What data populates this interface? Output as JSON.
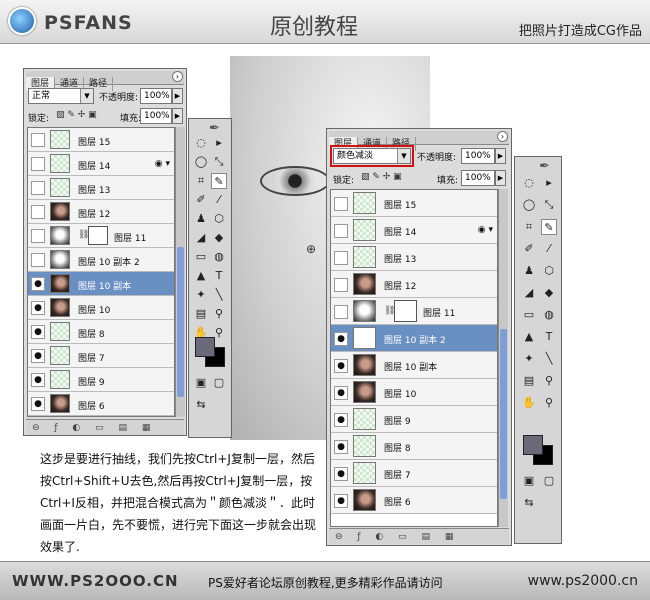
{
  "header": {
    "logo": "PSFANS",
    "title": "原创教程",
    "subtitle": "把照片打造成CG作品"
  },
  "left_panel": {
    "tabs": [
      "图层",
      "通道",
      "路径"
    ],
    "blend_mode": "正常",
    "opacity_label": "不透明度:",
    "opacity": "100%",
    "lock_label": "锁定:",
    "fill_label": "填充:",
    "fill": "100%",
    "layers": [
      {
        "name": "图层 15",
        "thumb": "grid",
        "visible": false
      },
      {
        "name": "图层 14",
        "thumb": "grid",
        "visible": false,
        "fx": true
      },
      {
        "name": "图层 13",
        "thumb": "grid",
        "visible": false
      },
      {
        "name": "图层 12",
        "thumb": "face",
        "visible": false
      },
      {
        "name": "图层 11",
        "thumb": "bw",
        "visible": false,
        "mask": true
      },
      {
        "name": "图层 10 副本 2",
        "thumb": "bw",
        "visible": false
      },
      {
        "name": "图层 10 副本",
        "thumb": "face",
        "visible": true,
        "selected": true
      },
      {
        "name": "图层 10",
        "thumb": "face",
        "visible": true
      },
      {
        "name": "图层 8",
        "thumb": "grid",
        "visible": true
      },
      {
        "name": "图层 7",
        "thumb": "grid",
        "visible": true
      },
      {
        "name": "图层 9",
        "thumb": "grid",
        "visible": true
      },
      {
        "name": "图层 6",
        "thumb": "face",
        "visible": true
      }
    ]
  },
  "right_panel": {
    "tabs": [
      "图层",
      "通道",
      "路径"
    ],
    "blend_mode": "颜色减淡",
    "opacity_label": "不透明度:",
    "opacity": "100%",
    "lock_label": "锁定:",
    "fill_label": "填充:",
    "fill": "100%",
    "layers": [
      {
        "name": "图层 15",
        "thumb": "grid",
        "visible": false
      },
      {
        "name": "图层 14",
        "thumb": "grid",
        "visible": false,
        "fx": true
      },
      {
        "name": "图层 13",
        "thumb": "grid",
        "visible": false
      },
      {
        "name": "图层 12",
        "thumb": "face",
        "visible": false
      },
      {
        "name": "图层 11",
        "thumb": "bw",
        "visible": false,
        "mask": true
      },
      {
        "name": "图层 10 副本 2",
        "thumb": "wt",
        "visible": true,
        "selected": true
      },
      {
        "name": "图层 10 副本",
        "thumb": "face",
        "visible": true
      },
      {
        "name": "图层 10",
        "thumb": "face",
        "visible": true
      },
      {
        "name": "图层 9",
        "thumb": "grid",
        "visible": true
      },
      {
        "name": "图层 8",
        "thumb": "grid",
        "visible": true
      },
      {
        "name": "图层 7",
        "thumb": "grid",
        "visible": true
      },
      {
        "name": "图层 6",
        "thumb": "face",
        "visible": true
      }
    ]
  },
  "tools": [
    "◌",
    "▸",
    "◯",
    "⤡",
    "⌗",
    "✎",
    "✐",
    "⁄",
    "♟",
    "⬡",
    "◢",
    "◆",
    "▭",
    "◍",
    "▲",
    "T",
    "✦",
    "╲",
    "▤",
    "⚲",
    "✋",
    "⚲"
  ],
  "description": "这步是要进行抽线，我们先按Ctrl+J复制一层，然后按Ctrl+Shift+U去色,然后再按Ctrl+J复制一层，按Ctrl+I反相，并把混合模式高为＂颜色减淡＂．此时画面一片白，先不要慌，进行完下面这一步就会出现效果了.",
  "footer": {
    "left": "WWW.PS2OOO.CN",
    "middle": "PS爱好者论坛原创教程,更多精彩作品请访问",
    "right": "www.ps2000.cn"
  },
  "colors": {
    "selected_row": "#6a8fc2",
    "highlight": "#d21010"
  }
}
